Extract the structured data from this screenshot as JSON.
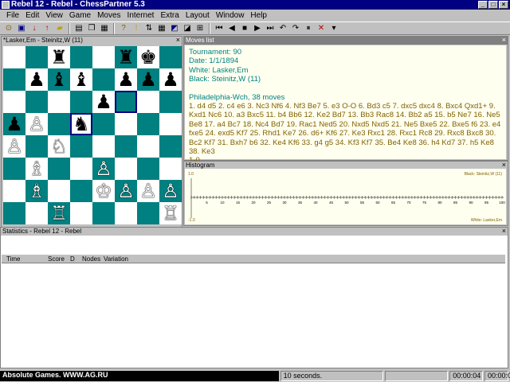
{
  "window": {
    "title": "Rebel 12 - Rebel - ChessPartner 5.3",
    "min_glyph": "_",
    "max_glyph": "□",
    "close_glyph": "×"
  },
  "menu": [
    "File",
    "Edit",
    "View",
    "Game",
    "Moves",
    "Internet",
    "Extra",
    "Layout",
    "Window",
    "Help"
  ],
  "board_panel": {
    "title": "*Lasker,Em - Steinitz,W (11)",
    "pieces": [
      {
        "row": 0,
        "col": 2,
        "glyph": "♜",
        "color": "black"
      },
      {
        "row": 0,
        "col": 5,
        "glyph": "♜",
        "color": "black"
      },
      {
        "row": 0,
        "col": 6,
        "glyph": "♚",
        "color": "black"
      },
      {
        "row": 1,
        "col": 1,
        "glyph": "♟",
        "color": "black"
      },
      {
        "row": 1,
        "col": 2,
        "glyph": "♝",
        "color": "black"
      },
      {
        "row": 1,
        "col": 3,
        "glyph": "♝",
        "color": "black"
      },
      {
        "row": 1,
        "col": 5,
        "glyph": "♟",
        "color": "black"
      },
      {
        "row": 1,
        "col": 6,
        "glyph": "♟",
        "color": "black"
      },
      {
        "row": 1,
        "col": 7,
        "glyph": "♟",
        "color": "black"
      },
      {
        "row": 2,
        "col": 4,
        "glyph": "♟",
        "color": "black"
      },
      {
        "row": 3,
        "col": 0,
        "glyph": "♟",
        "color": "black"
      },
      {
        "row": 3,
        "col": 1,
        "glyph": "♙",
        "color": "white"
      },
      {
        "row": 3,
        "col": 3,
        "glyph": "♞",
        "color": "black"
      },
      {
        "row": 4,
        "col": 0,
        "glyph": "♙",
        "color": "white"
      },
      {
        "row": 4,
        "col": 2,
        "glyph": "♘",
        "color": "white"
      },
      {
        "row": 5,
        "col": 1,
        "glyph": "♗",
        "color": "white"
      },
      {
        "row": 5,
        "col": 4,
        "glyph": "♙",
        "color": "white"
      },
      {
        "row": 6,
        "col": 1,
        "glyph": "♗",
        "color": "white"
      },
      {
        "row": 6,
        "col": 4,
        "glyph": "♔",
        "color": "white"
      },
      {
        "row": 6,
        "col": 5,
        "glyph": "♙",
        "color": "white"
      },
      {
        "row": 6,
        "col": 6,
        "glyph": "♙",
        "color": "white"
      },
      {
        "row": 6,
        "col": 7,
        "glyph": "♙",
        "color": "white"
      },
      {
        "row": 7,
        "col": 2,
        "glyph": "♖",
        "color": "white"
      },
      {
        "row": 7,
        "col": 7,
        "glyph": "♖",
        "color": "white"
      }
    ]
  },
  "moves_panel": {
    "title": "Moves list",
    "tournament": "Tournament: 90",
    "date": "Date: 1/1/1894",
    "white": "White: Lasker,Em",
    "black": "Black: Steinitz,W (11)",
    "event": "Philadelphia-Wch, 38 moves",
    "moves": "1. d4 d5 2. c4 e6 3. Nc3 Nf6 4. Nf3 Be7 5. e3 O-O 6. Bd3 c5 7. dxc5 dxc4 8. Bxc4 Qxd1+ 9. Kxd1 Nc6 10. a3 Bxc5 11. b4 Bb6 12. Ke2 Bd7 13. Bb3 Rac8 14. Bb2 a5 15. b5 Ne7 16. Ne5 Be8 17. a4 Bc7 18. Nc4 Bd7 19. Rac1 Ned5 20. Nxd5 Nxd5 21. Ne5 Bxe5 22. Bxe5 f6 23. e4 fxe5 24. exd5 Kf7 25. Rhd1 Ke7 26. d6+ Kf6 27. Ke3 Rxc1 28. Rxc1 Rc8 29. Rxc8 Bxc8 30. Bc2 Kf7 31. Bxh7 b6 32. Ke4 Kf6 33. g4 g5 34. Kf3 Kf7 35. Be4 Ke8 36. h4 Kd7 37. h5 Ke8 38. Ke3",
    "result": "1-0"
  },
  "histogram": {
    "title": "Histogram",
    "top_label": "1.0",
    "bottom_label": "-1.0",
    "black_legend": "Black: Steinitz,W (11)",
    "white_legend": "White: Lasker,Em",
    "x_ticks": [
      "5",
      "10",
      "15",
      "20",
      "25",
      "30",
      "35",
      "40",
      "45",
      "50",
      "55",
      "60",
      "65",
      "70",
      "75",
      "80",
      "85",
      "90",
      "95",
      "100"
    ]
  },
  "stats_panel": {
    "title": "Statistics - Rebel 12 - Rebel",
    "columns": [
      "Time",
      "Score",
      "D",
      "Nodes",
      "Variation"
    ]
  },
  "status": {
    "ad": "Absolute Games. WWW.AG.RU",
    "time_setting": "10 seconds.",
    "clock1": "00:00:04",
    "clock2": "00:00:00"
  }
}
